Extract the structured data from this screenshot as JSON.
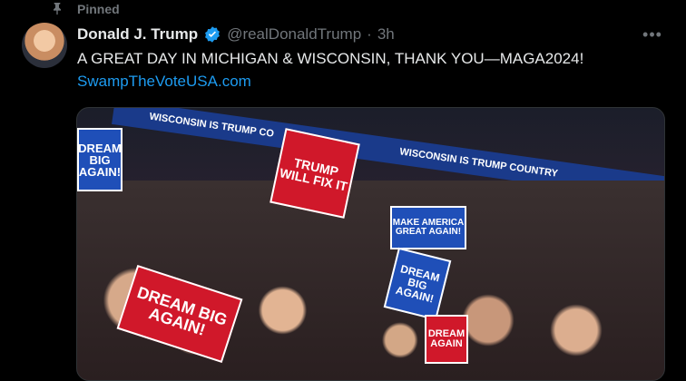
{
  "pinned": {
    "label": "Pinned",
    "icon": "pin-icon"
  },
  "author": {
    "name": "Donald J. Trump",
    "handle": "@realDonaldTrump",
    "separator": "·",
    "time": "3h",
    "verified_icon": "verified-badge-icon"
  },
  "tweet": {
    "text": "A GREAT DAY IN MICHIGAN & WISCONSIN, THANK YOU—MAGA2024!",
    "link": "SwampTheVoteUSA.com"
  },
  "media": {
    "banner_left": "WISCONSIN IS TRUMP CO",
    "banner_right": "WISCONSIN IS TRUMP COUNTRY",
    "signs": [
      {
        "line1": "DREAM BIG",
        "line2": "AGAIN!"
      },
      {
        "line1": "TRUMP",
        "line2": "WILL FIX IT"
      },
      {
        "line1": "MAKE AMERICA",
        "line2": "GREAT AGAIN!"
      },
      {
        "line1": "DREAM BIG",
        "line2": "AGAIN!"
      },
      {
        "line1": "DREAM BIG",
        "line2": "AGAIN!"
      },
      {
        "line1": "DREAM",
        "line2": "AGAIN"
      }
    ]
  },
  "colors": {
    "accent": "#1d9bf0",
    "muted": "#71767b",
    "text": "#e7e9ea",
    "bg": "#000000"
  }
}
